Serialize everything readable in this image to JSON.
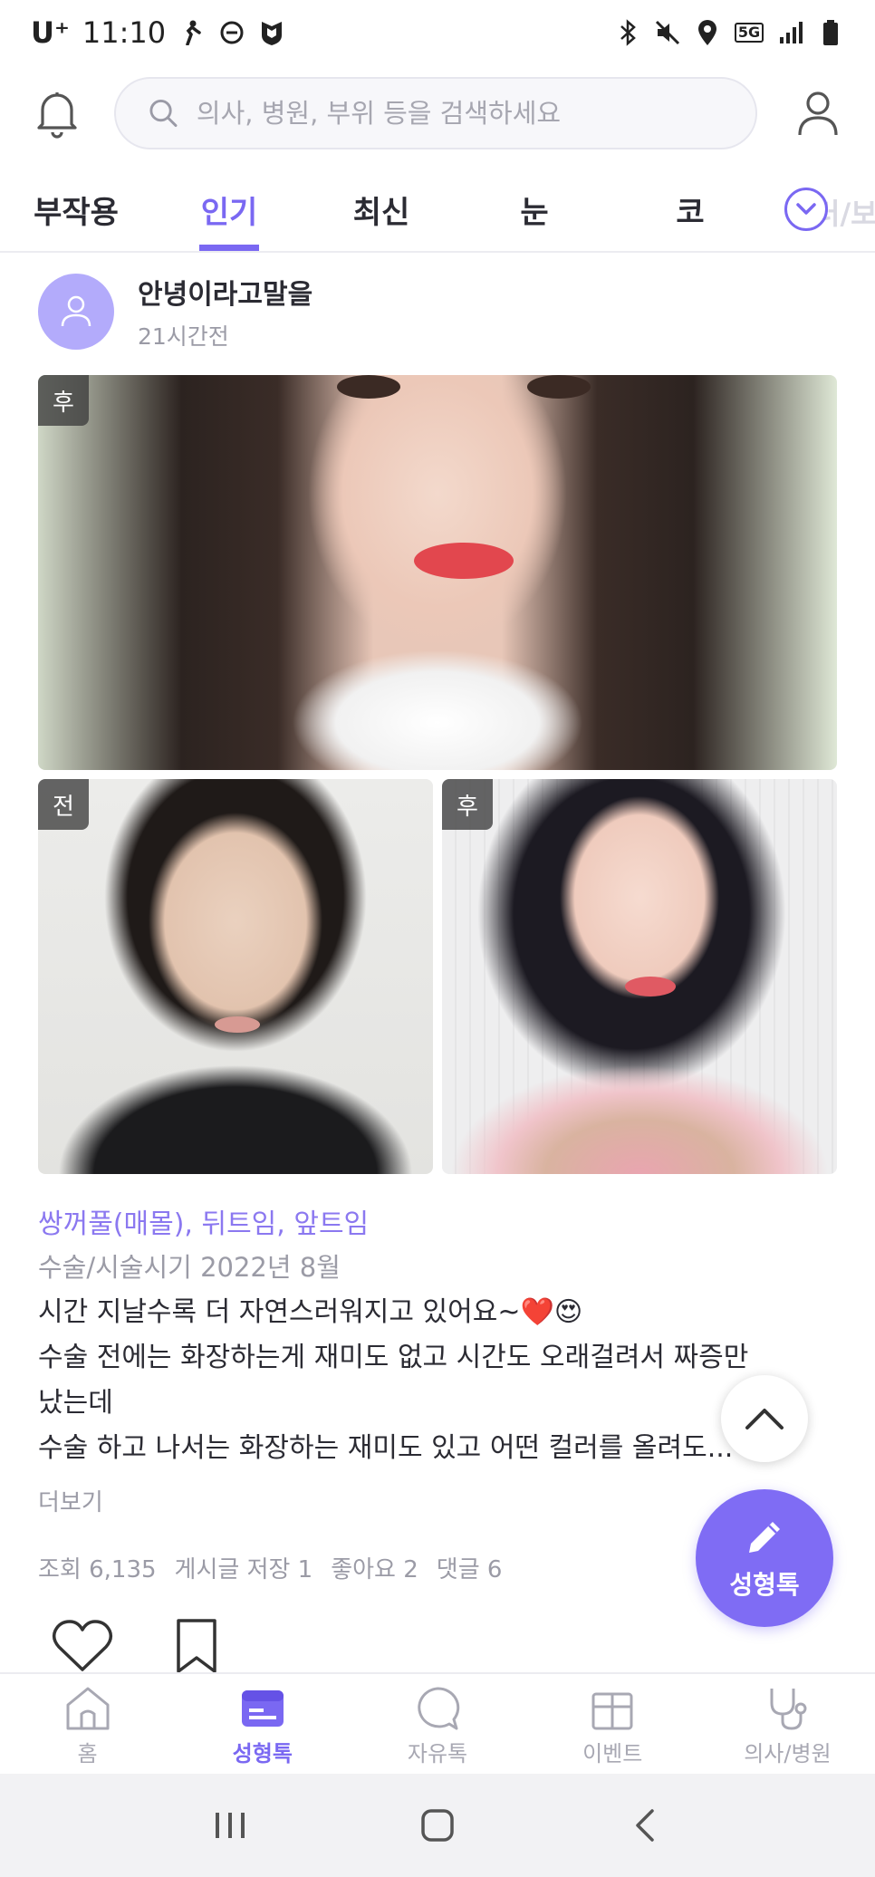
{
  "status_bar": {
    "carrier": "U⁺",
    "time": "11:10",
    "network": "5G"
  },
  "search": {
    "placeholder": "의사, 병원, 부위 등을 검색하세요"
  },
  "tabs": [
    {
      "label": "부작용"
    },
    {
      "label": "인기"
    },
    {
      "label": "최신"
    },
    {
      "label": "눈"
    },
    {
      "label": "코"
    }
  ],
  "tab_overflow_ghost": "러/보",
  "post": {
    "author": "안녕이라고말을",
    "time_ago": "21시간전",
    "photos": {
      "main_tag": "후",
      "before_tag": "전",
      "after_tag": "후"
    },
    "tags": "쌍꺼풀(매몰), 뒤트임, 앞트임",
    "surgery_date": "수술/시술시기 2022년 8월",
    "body_lines": [
      "시간 지날수록 더 자연스러워지고 있어요~❤️😍",
      "수술 전에는 화장하는게 재미도 없고 시간도 오래걸려서 짜증만",
      "났는데",
      "수술 하고 나서는 화장하는 재미도 있고 어떤 컬러를 올려도..."
    ],
    "more_label": "더보기",
    "stats": {
      "views": "조회 6,135",
      "saves": "게시글 저장 1",
      "likes": "좋아요 2",
      "comments": "댓글 6"
    }
  },
  "fab": {
    "label": "성형톡"
  },
  "bottom_nav": [
    {
      "label": "홈",
      "icon": "home-icon"
    },
    {
      "label": "성형톡",
      "icon": "chat-board-icon"
    },
    {
      "label": "자유톡",
      "icon": "speech-bubble-icon"
    },
    {
      "label": "이벤트",
      "icon": "gift-icon"
    },
    {
      "label": "의사/병원",
      "icon": "stethoscope-icon"
    }
  ],
  "colors": {
    "accent": "#7a68f2",
    "fab": "#7f6cf4",
    "muted": "#9b9ba6",
    "tag_text": "#8b78f0"
  }
}
